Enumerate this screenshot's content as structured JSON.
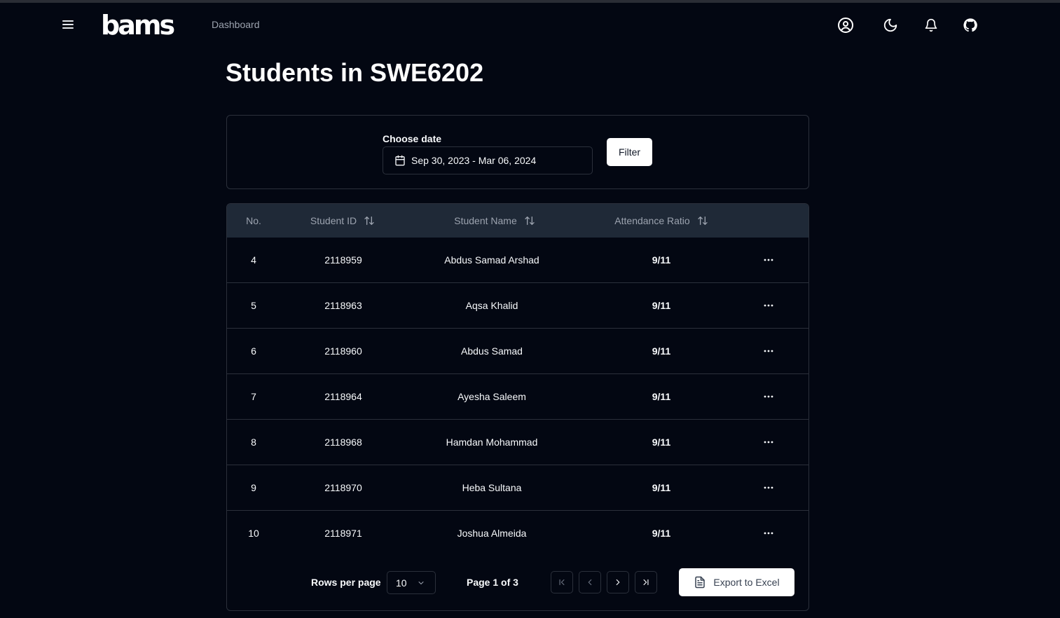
{
  "app": {
    "logo": "bams"
  },
  "nav": {
    "dashboard": "Dashboard"
  },
  "page": {
    "title": "Students in SWE6202"
  },
  "filter": {
    "date_label": "Choose date",
    "date_value": "Sep 30, 2023 - Mar 06, 2024",
    "filter_button": "Filter"
  },
  "table": {
    "headers": {
      "no": "No.",
      "student_id": "Student ID",
      "student_name": "Student Name",
      "attendance_ratio": "Attendance Ratio"
    },
    "rows": [
      {
        "no": "4",
        "id": "2118959",
        "name": "Abdus Samad Arshad",
        "ratio": "9/11"
      },
      {
        "no": "5",
        "id": "2118963",
        "name": "Aqsa Khalid",
        "ratio": "9/11"
      },
      {
        "no": "6",
        "id": "2118960",
        "name": "Abdus Samad",
        "ratio": "9/11"
      },
      {
        "no": "7",
        "id": "2118964",
        "name": "Ayesha Saleem",
        "ratio": "9/11"
      },
      {
        "no": "8",
        "id": "2118968",
        "name": "Hamdan Mohammad",
        "ratio": "9/11"
      },
      {
        "no": "9",
        "id": "2118970",
        "name": "Heba Sultana",
        "ratio": "9/11"
      },
      {
        "no": "10",
        "id": "2118971",
        "name": "Joshua Almeida",
        "ratio": "9/11"
      }
    ]
  },
  "pagination": {
    "rows_per_page_label": "Rows per page",
    "rows_per_page_value": "10",
    "page_info": "Page 1 of 3",
    "export_label": "Export to Excel"
  },
  "icons": {
    "menu": "menu-icon",
    "profile": "user-circle-icon",
    "theme": "moon-icon",
    "notifications": "bell-icon",
    "github": "github-icon",
    "calendar": "calendar-icon",
    "sort": "sort-icon",
    "more": "ellipsis-icon",
    "first": "first-page-icon",
    "prev": "chevron-left-icon",
    "next": "chevron-right-icon",
    "last": "last-page-icon",
    "export": "document-icon"
  },
  "colors": {
    "background": "#030712",
    "table_header": "#1f2937",
    "border": "#2b303b",
    "muted_text": "#9ca3af",
    "button_bg": "#ffffff"
  }
}
